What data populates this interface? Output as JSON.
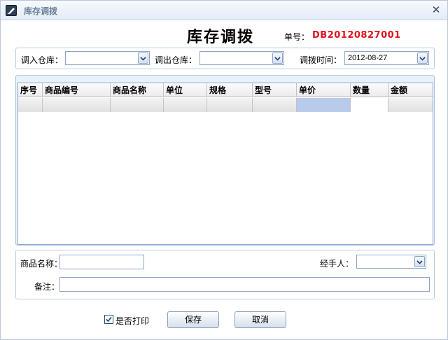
{
  "window": {
    "title": "库存调拨",
    "close_icon": "✕"
  },
  "header": {
    "main_title": "库存调拨",
    "order_no_label": "单号：",
    "order_no_value": "DB20120827001",
    "order_no_color": "#e0101a"
  },
  "filters": {
    "transfer_in_label": "调入仓库：",
    "transfer_in_value": "",
    "transfer_out_label": "调出仓库：",
    "transfer_out_value": "",
    "transfer_time_label": "调拨时间：",
    "transfer_time_value": "2012-08-27"
  },
  "table": {
    "columns": [
      "序号",
      "商品编号",
      "商品名称",
      "单位",
      "规格",
      "型号",
      "单价",
      "数量",
      "金额"
    ],
    "rows": [
      [
        "",
        "",
        "",
        "",
        "",
        "",
        "",
        "",
        ""
      ]
    ],
    "selected_color": "#b9cbea"
  },
  "details": {
    "product_name_label": "商品名称：",
    "product_name_value": "",
    "handler_label": "经手人：",
    "handler_value": "",
    "remark_label": "备注：",
    "remark_value": ""
  },
  "footer": {
    "print_label": "是否打印",
    "print_checked": true,
    "save_label": "保存",
    "cancel_label": "取消"
  }
}
